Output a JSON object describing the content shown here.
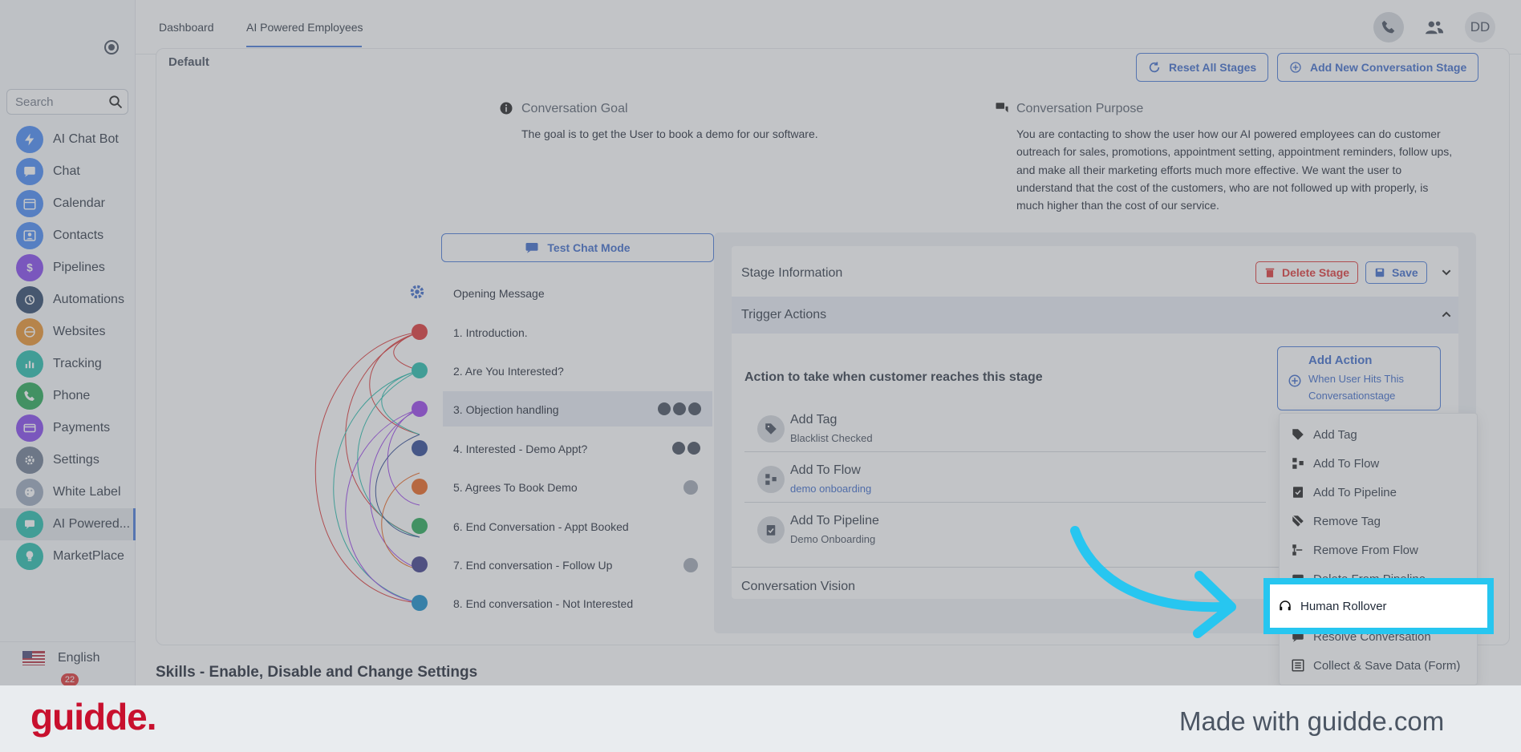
{
  "sidebar": {
    "search_placeholder": "Search",
    "items": [
      {
        "label": "AI Chat Bot",
        "icon": "bolt-icon",
        "color": "#3b82f6"
      },
      {
        "label": "Chat",
        "icon": "chat-icon",
        "color": "#3b82f6"
      },
      {
        "label": "Calendar",
        "icon": "calendar-icon",
        "color": "#3b82f6"
      },
      {
        "label": "Contacts",
        "icon": "contacts-icon",
        "color": "#3b82f6"
      },
      {
        "label": "Pipelines",
        "icon": "dollar-icon",
        "color": "#7c3aed"
      },
      {
        "label": "Automations",
        "icon": "automation-icon",
        "color": "#1e3a5f"
      },
      {
        "label": "Websites",
        "icon": "globe-icon",
        "color": "#ea8a1e"
      },
      {
        "label": "Tracking",
        "icon": "chart-icon",
        "color": "#14b8a6"
      },
      {
        "label": "Phone",
        "icon": "phone-icon",
        "color": "#16a34a"
      },
      {
        "label": "Payments",
        "icon": "card-icon",
        "color": "#7c3aed"
      },
      {
        "label": "Settings",
        "icon": "gear-icon",
        "color": "#64748b"
      },
      {
        "label": "White Label",
        "icon": "palette-icon",
        "color": "#94a3b8"
      },
      {
        "label": "AI Powered...",
        "icon": "ai-chat-icon",
        "color": "#14b8a6"
      },
      {
        "label": "MarketPlace",
        "icon": "bulb-icon",
        "color": "#14b8a6"
      }
    ],
    "language": "English",
    "notification_count": "22"
  },
  "topbar": {
    "tabs": [
      "Dashboard",
      "AI Powered Employees"
    ],
    "avatar_initials": "DD"
  },
  "card": {
    "title": "Default",
    "reset_label": "Reset All Stages",
    "add_stage_label": "Add New Conversation Stage",
    "goal_title": "Conversation Goal",
    "goal_text": "The goal is to get the User to book a demo for our software.",
    "purpose_title": "Conversation Purpose",
    "purpose_lines": [
      "You are contacting to show the user how our AI powered employees can do customer",
      "outreach for sales, promotions, appointment setting, appointment reminders, follow ups,",
      "and make all their marketing efforts much more effective. We want the user to",
      "understand that the cost of the customers, who are not followed up with properly, is",
      "much higher than the cost of our service."
    ],
    "test_chat_label": "Test Chat Mode",
    "opening_message": "Opening Message",
    "stages": [
      {
        "label": "1. Introduction.",
        "color": "#dc2626"
      },
      {
        "label": "2. Are You Interested?",
        "color": "#14b8a6"
      },
      {
        "label": "3. Objection handling",
        "color": "#9333ea"
      },
      {
        "label": "4. Interested - Demo Appt?",
        "color": "#1e3a8a"
      },
      {
        "label": "5. Agrees To Book Demo",
        "color": "#ea580c"
      },
      {
        "label": "6. End Conversation - Appt Booked",
        "color": "#16a34a"
      },
      {
        "label": "7. End conversation - Follow Up",
        "color": "#312e81"
      },
      {
        "label": "8. End conversation - Not Interested",
        "color": "#0284c7"
      }
    ]
  },
  "stage_panel": {
    "info_title": "Stage Information",
    "delete_label": "Delete Stage",
    "save_label": "Save",
    "trigger_title": "Trigger Actions",
    "action_prompt": "Action to take when customer reaches this stage",
    "add_action_title": "Add Action",
    "add_action_sub1": "When User Hits This",
    "add_action_sub2": "Conversationstage",
    "actions": [
      {
        "title": "Add Tag",
        "sub": "Blacklist Checked",
        "icon": "tag-icon"
      },
      {
        "title": "Add To Flow",
        "sub": "demo onboarding",
        "icon": "flow-icon"
      },
      {
        "title": "Add To Pipeline",
        "sub": "Demo Onboarding",
        "icon": "clipboard-check-icon"
      }
    ],
    "vision_title": "Conversation Vision"
  },
  "dropdown": {
    "items": [
      {
        "label": "Add Tag",
        "icon": "tag-icon"
      },
      {
        "label": "Add To Flow",
        "icon": "flow-icon"
      },
      {
        "label": "Add To Pipeline",
        "icon": "clipboard-check-icon"
      },
      {
        "label": "Remove Tag",
        "icon": "tag-off-icon"
      },
      {
        "label": "Remove From Flow",
        "icon": "flow-remove-icon"
      },
      {
        "label": "Delete From Pipeline",
        "icon": "calendar-x-icon"
      },
      {
        "label": "Human Rollover",
        "icon": "headset-icon"
      },
      {
        "label": "Resolve Conversation",
        "icon": "chat-check-icon"
      },
      {
        "label": "Collect & Save Data (Form)",
        "icon": "form-icon"
      }
    ]
  },
  "skills_title": "Skills - Enable, Disable and Change Settings",
  "footer": {
    "brand": "guidde.",
    "tagline": "Made with guidde.com"
  },
  "colors": {
    "accent": "#3b6fd6",
    "highlight": "#27c6f0",
    "brand_red": "#c8102e"
  }
}
